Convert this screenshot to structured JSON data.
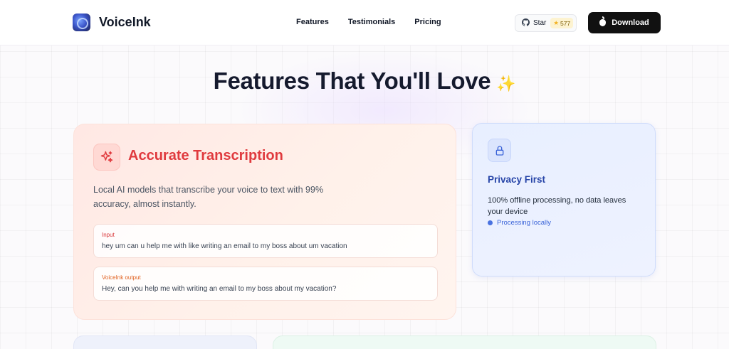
{
  "brand": {
    "name": "VoiceInk"
  },
  "nav": {
    "links": [
      "Features",
      "Testimonials",
      "Pricing"
    ],
    "star_label": "Star",
    "star_count": "577",
    "download_label": "Download"
  },
  "hero": {
    "title": "Features That You'll Love",
    "emoji": "✨"
  },
  "feature_main": {
    "title": "Accurate Transcription",
    "description": "Local AI models that transcribe your voice to text with 99% accuracy, almost instantly.",
    "input_label": "Input",
    "input_text": "hey um can u help me with like writing an email to my boss about um vacation",
    "output_label": "VoiceInk output",
    "output_text": "Hey, can you help me with writing an email to my boss about my vacation?",
    "icon": "sparkles-icon",
    "accent": "#e03a3e"
  },
  "feature_privacy": {
    "title": "Privacy First",
    "description": "100% offline processing, no data leaves your device",
    "status": "Processing locally",
    "icon": "lock-icon",
    "accent": "#2745a8"
  }
}
